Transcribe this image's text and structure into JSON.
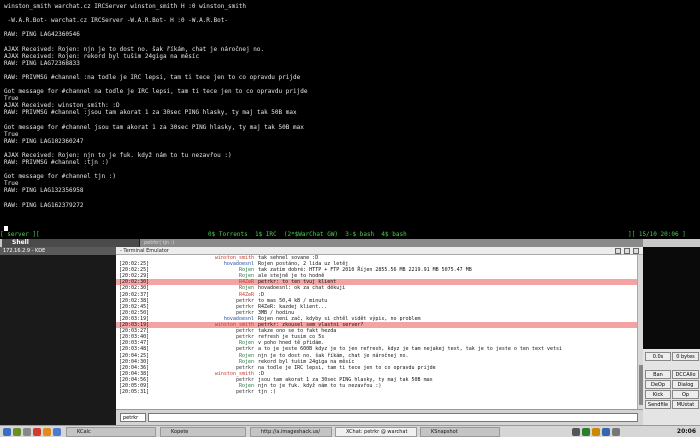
{
  "terminal": {
    "lines": [
      "winston_smith warchat.cz IRCServer winston_smith H :0 winston_smith",
      "",
      " -W.A.R.Bot- warchat.cz IRCServer -W.A.R.Bot- H :0 -W.A.R.Bot-",
      "",
      "RAW: PING LAG42360546",
      "",
      "AJAX Received: Rojen: njn je to dost no. šak říkám, chat je náročnej no.",
      "AJAX Received: Rojen: rekord byl tušim 24giga na měsíc",
      "RAW: PING LAG72368833",
      "",
      "RAW: PRIVMSG #channel :na todle je IRC lepsi, tam ti tece jen to co opravdu prijde",
      "",
      "Got message for #channel na todle je IRC lepsi, tam ti tece jen to co opravdu prijde",
      "True",
      "AJAX Received: winston_smith: :D",
      "RAW: PRIVMSG #channel :jsou tam akorat 1 za 30sec PING hlasky, ty maj tak 50B max",
      "",
      "Got message for #channel jsou tam akorat 1 za 30sec PING hlasky, ty maj tak 50B max",
      "True",
      "RAW: PING LAG102360247",
      "",
      "AJAX Received: Rojen: njn to je fuk. když nám to tu nezavřou :)",
      "RAW: PRIVMSG #channel :tjn :)",
      "",
      "Got message for #channel tjn :)",
      "True",
      "RAW: PING LAG132356958",
      "",
      "RAW: PING LAG162379272",
      "",
      ""
    ]
  },
  "screenbar": {
    "left": "[ server ][",
    "windows": "0$ Torrents  1$ IRC  (2*$WarChat GW)  3-$ bash  4$ bash",
    "right": "][ 15/10 20:06 ]"
  },
  "kicker": {
    "shell_label": "Shell",
    "mid_text": "petrkr| tjn :)"
  },
  "konsole": {
    "left_title": "172.16.2.9 - KDE",
    "title": "- Terminal Emulator"
  },
  "chat": {
    "rows": [
      {
        "time": "",
        "nick": "winston_smith",
        "msg": "tak sehnel sovane :D",
        "hl": false
      },
      {
        "time": "[20:02:25]",
        "nick": "hovadoesnl",
        "msg": "Rojen postáno, 2 lida uz letěj",
        "hl": false
      },
      {
        "time": "[20:02:25]",
        "nick": "Rojen",
        "msg": "tak zatím dobré: HTTP + FTP    2010    Říjen    2855.56 MB    2219.91 MB    5075.47 MB",
        "hl": false
      },
      {
        "time": "[20:02:29]",
        "nick": "Rojen",
        "msg": "ale stejně je to hodně",
        "hl": false
      },
      {
        "time": "[20:02:30]",
        "nick": "R4ZeR",
        "msg": "petrkr: to ten tvuj klient",
        "hl": true
      },
      {
        "time": "[20:02:30]",
        "nick": "Rojen",
        "msg": "hovadoesnl: ok za chat děkuji",
        "hl": false
      },
      {
        "time": "[20:02:37]",
        "nick": "R4ZeR",
        "msg": ":D",
        "hl": false
      },
      {
        "time": "[20:02:38]",
        "nick": "petrkr",
        "msg": "to mas 50,4 kB / minutu",
        "hl": false
      },
      {
        "time": "[20:02:45]",
        "nick": "petrkr",
        "msg": "R4ZeR: kazdej klient...",
        "hl": false
      },
      {
        "time": "[20:02:50]",
        "nick": "petrkr",
        "msg": "3MB / hodinu",
        "hl": false
      },
      {
        "time": "[20:03:19]",
        "nick": "hovadoesnl",
        "msg": "Rojen není zač, kdyby si chtěl vidět výpis, no problem",
        "hl": false
      },
      {
        "time": "[20:03:19]",
        "nick": "winston_smith",
        "msg": "petrkr: zkousel sem vlastni server?",
        "hl": true
      },
      {
        "time": "[20:03:27]",
        "nick": "petrkr",
        "msg": "takze ono se to fakt hezda",
        "hl": false
      },
      {
        "time": "[20:03:40]",
        "nick": "petrkr",
        "msg": "refresh je tusim co 5s",
        "hl": false
      },
      {
        "time": "[20:03:47]",
        "nick": "Rojen",
        "msg": "v poho hned tě přidám.",
        "hl": false
      },
      {
        "time": "[20:03:48]",
        "nick": "petrkr",
        "msg": "a to je jeste 600B kdyz je to jen refresh, kdyz je tam nejakej text, tak je to jeste o ten text vetsi",
        "hl": false
      },
      {
        "time": "[20:04:25]",
        "nick": "Rojen",
        "msg": "njn je to dost no. šak říkám, chat je náročnej no.",
        "hl": false
      },
      {
        "time": "[20:04:30]",
        "nick": "Rojen",
        "msg": "rekord byl tušim 24giga na měsíc",
        "hl": false
      },
      {
        "time": "[20:04:36]",
        "nick": "petrkr",
        "msg": "na todle je IRC lepsi, tam ti tece jen to co opravdu prijde",
        "hl": false
      },
      {
        "time": "[20:04:38]",
        "nick": "winston_smith",
        "msg": ":D",
        "hl": false
      },
      {
        "time": "[20:04:56]",
        "nick": "petrkr",
        "msg": "jsou tam akorat 1 za 30sec PING hlasky, ty maj tak 50B max",
        "hl": false
      },
      {
        "time": "[20:05:09]",
        "nick": "Rojen",
        "msg": "njn to je fuk. když nám to tu nezavřou :)",
        "hl": false
      },
      {
        "time": "[20:05:31]",
        "nick": "petrkr",
        "msg": "tjn :)",
        "hl": false
      }
    ]
  },
  "input": {
    "nick": "petrkr"
  },
  "rightpanel": {
    "stat_left": "0.0s",
    "stat_right": "0 bytes",
    "buttons": [
      "Ban",
      "DCCAllo",
      "DeOp",
      "Dialog",
      "Kick",
      "Op",
      "Sendfile",
      "MUstat"
    ]
  },
  "taskbar": {
    "tasks": [
      "KCalc",
      "Kopete",
      "http://a.imageshack.us/",
      "XChat: petrkr @ warchat",
      "KSnapshot"
    ],
    "clock": "20:06"
  }
}
